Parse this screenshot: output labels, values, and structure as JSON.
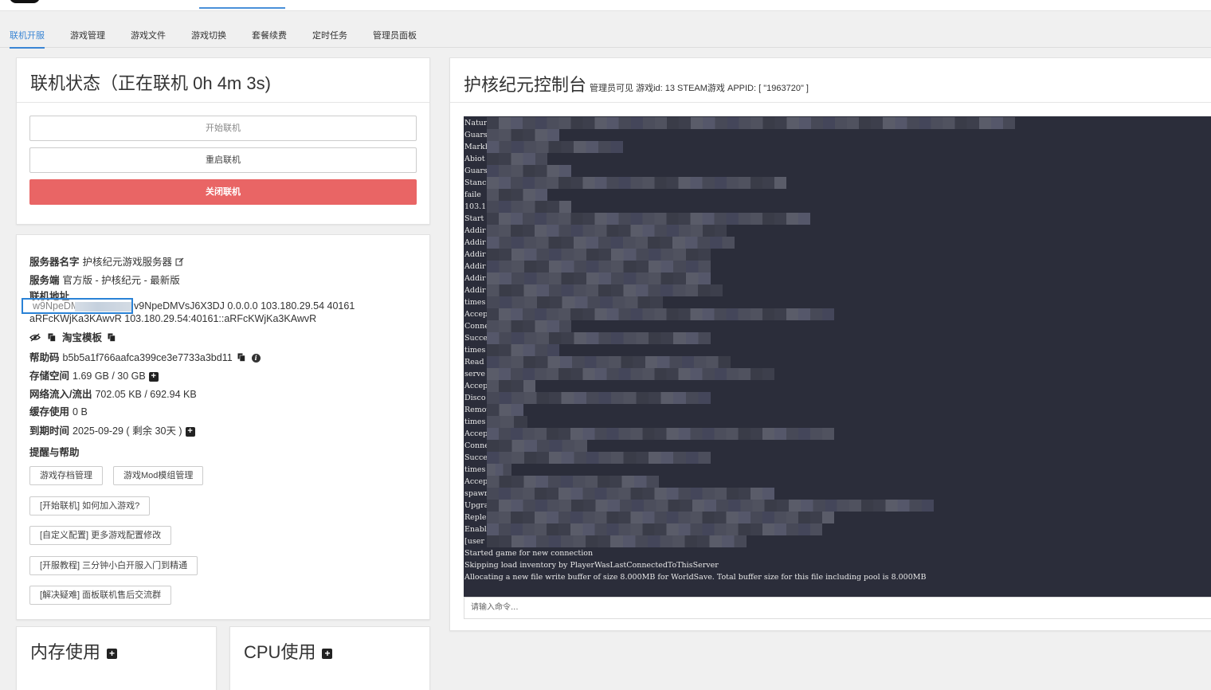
{
  "tabs": [
    {
      "label": "联机开服",
      "active": true
    },
    {
      "label": "游戏管理",
      "active": false
    },
    {
      "label": "游戏文件",
      "active": false
    },
    {
      "label": "游戏切换",
      "active": false
    },
    {
      "label": "套餐续费",
      "active": false
    },
    {
      "label": "定时任务",
      "active": false
    },
    {
      "label": "管理员面板",
      "active": false
    }
  ],
  "status": {
    "title": "联机状态（正在联机 0h 4m 3s)",
    "start_label": "开始联机",
    "restart_label": "重启联机",
    "close_label": "关闭联机"
  },
  "info": {
    "server_name_label": "服务器名字",
    "server_name": "护核纪元游戏服务器",
    "server_side_label": "服务端",
    "server_side": "官方版 - 护核纪元 - 最新版",
    "address_label": "联机地址",
    "address_line1_prefix": "w9NpeDMV",
    "address_line1": "v9NpeDMVsJ6X3DJ 0.0.0.0 103.180.29.54 40161",
    "address_line2": "aRFcKWjKa3KAwvR 103.180.29.54:40161::aRFcKWjKa3KAwvR",
    "taobao_label": "淘宝模板",
    "help_code_label": "帮助码",
    "help_code": "b5b5a1f766aafca399ce3e7733a3bd11",
    "storage_label": "存储空间",
    "storage": "1.69 GB / 30 GB",
    "network_label": "网络流入/流出",
    "network": "702.05 KB / 692.94 KB",
    "cache_label": "缓存使用",
    "cache": "0 B",
    "expire_label": "到期时间",
    "expire": "2025-09-29 ( 剩余 30天 )",
    "help_label": "提醒与帮助",
    "buttons": [
      "游戏存档管理",
      "游戏Mod模组管理",
      "[开始联机] 如何加入游戏?",
      "[自定义配置] 更多游戏配置修改",
      "[开服教程] 三分钟小白开服入门到精通",
      "[解决疑难] 面板联机售后交流群"
    ]
  },
  "memory": {
    "title": "内存使用"
  },
  "cpu": {
    "title": "CPU使用"
  },
  "console": {
    "title": "护核纪元控制台",
    "subtitle": "管理员可见 游戏id: 13 STEAM游戏 APPID: [ \"1963720\" ]",
    "lines": [
      "Natur",
      "Guars",
      "Markh",
      "Abiot",
      "Guars",
      "Stanc",
      "faile",
      "103.1",
      "Start",
      "Addir",
      "Addir",
      "Addir",
      "Addir",
      "Addir",
      "Addir",
      "times",
      "Accep",
      "Conne",
      "Succe",
      "times",
      "Read",
      "serve",
      "Accep",
      "Disco",
      "Remov",
      "times",
      "Accep",
      "Conne",
      "Succe",
      "times",
      "Accep",
      "spawr",
      "Upgra",
      "Reple",
      "Enabl",
      "[user",
      "Started game for new connection",
      "Skipping load inventory by PlayerWasLastConnectedToThisServer",
      "Allocating a new file write buffer of size 8.000MB for WorldSave. Total buffer size for this file including pool is 8.000MB"
    ],
    "input_placeholder": "请输入命令..."
  }
}
